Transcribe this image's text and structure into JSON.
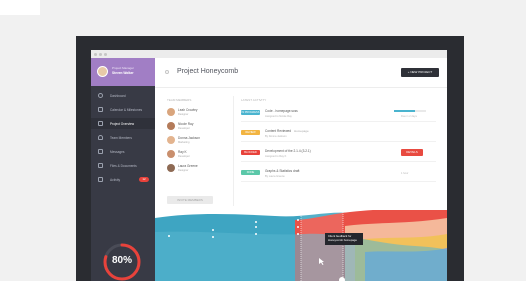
{
  "window": {
    "title": "Project Honeycomb",
    "new_project_label": "+ NEW PROJECT"
  },
  "profile": {
    "subtitle": "Project Manager",
    "name": "Steven Walker"
  },
  "sidebar": {
    "items": [
      {
        "label": "Dashboard",
        "icon": "clock-icon"
      },
      {
        "label": "Calendar & Milestones",
        "icon": "calendar-icon"
      },
      {
        "label": "Project Overview",
        "icon": "grid-icon",
        "active": true
      },
      {
        "label": "Team Members",
        "icon": "person-icon"
      },
      {
        "label": "Messages",
        "icon": "mail-icon"
      },
      {
        "label": "Files & Documents",
        "icon": "file-icon"
      },
      {
        "label": "Activity",
        "icon": "folder-icon",
        "badge": "12"
      }
    ]
  },
  "gauge": {
    "value": 80,
    "label": "80%",
    "color": "#e8423b"
  },
  "members": {
    "heading": "TEAM MEMBERS",
    "list": [
      {
        "name": "Leah Crowley",
        "role": "Designer"
      },
      {
        "name": "Nicole Ray",
        "role": "Developer"
      },
      {
        "name": "Donna Jackson",
        "role": "Marketing"
      },
      {
        "name": "Ray K",
        "role": "Developer"
      },
      {
        "name": "Laura Greene",
        "role": "Designer"
      }
    ],
    "invite_label": "INVITE MEMBERS"
  },
  "activity": {
    "heading": "LATEST ACTIVITY",
    "tasks": [
      {
        "tag": "IN PROGRESS",
        "tag_color": "#4ab4cf",
        "title": "Code - homepage.scss",
        "extra": "",
        "sub": "Assigned to Nicole Ray",
        "progress": 0.65,
        "right": "Due in 2 days"
      },
      {
        "tag": "REVIEW",
        "tag_color": "#f2b441",
        "title": "Content Reviewed",
        "extra": "Homepage",
        "sub": "By Donna Jackson",
        "right": ""
      },
      {
        "tag": "BLOCKED",
        "tag_color": "#e8423b",
        "title": "Development of the 2.1.4 (3.2.1)",
        "extra": "",
        "sub": "Assigned to Ray K",
        "button": "DETAILS"
      },
      {
        "tag": "DONE",
        "tag_color": "#5bc8a9",
        "title": "Graphs & Statistics draft",
        "extra": "",
        "sub": "By Laura Greene",
        "right": "1 hour"
      }
    ]
  },
  "tooltip": {
    "line1": "Client feedback for",
    "line2": "Honeycomb homepage"
  },
  "colors": {
    "teal": "#4ab4cf",
    "red": "#e8423b",
    "dark": "#383a45",
    "purple": "#a17ec5"
  }
}
